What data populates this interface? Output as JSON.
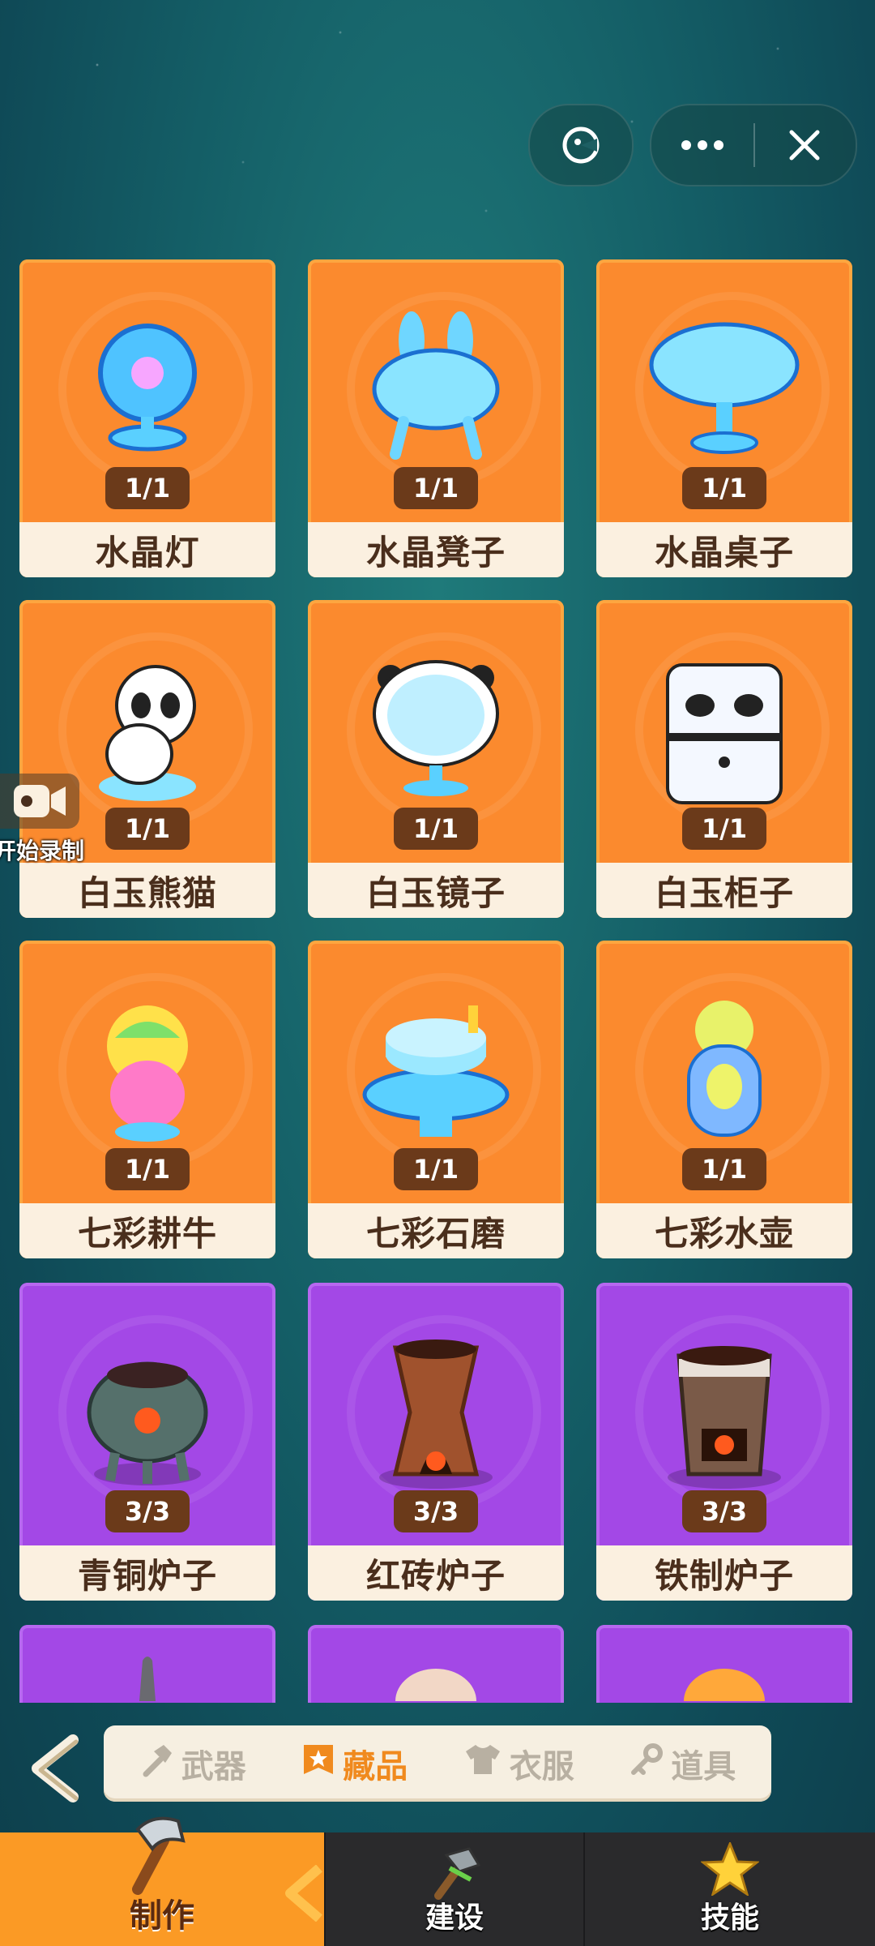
{
  "cards": [
    {
      "name": "水晶灯",
      "count": "1/1",
      "tier": "orange"
    },
    {
      "name": "水晶凳子",
      "count": "1/1",
      "tier": "orange"
    },
    {
      "name": "水晶桌子",
      "count": "1/1",
      "tier": "orange"
    },
    {
      "name": "白玉熊猫",
      "count": "1/1",
      "tier": "orange"
    },
    {
      "name": "白玉镜子",
      "count": "1/1",
      "tier": "orange"
    },
    {
      "name": "白玉柜子",
      "count": "1/1",
      "tier": "orange"
    },
    {
      "name": "七彩耕牛",
      "count": "1/1",
      "tier": "orange"
    },
    {
      "name": "七彩石磨",
      "count": "1/1",
      "tier": "orange"
    },
    {
      "name": "七彩水壶",
      "count": "1/1",
      "tier": "orange"
    },
    {
      "name": "青铜炉子",
      "count": "3/3",
      "tier": "purple"
    },
    {
      "name": "红砖炉子",
      "count": "3/3",
      "tier": "purple"
    },
    {
      "name": "铁制炉子",
      "count": "3/3",
      "tier": "purple"
    }
  ],
  "record": {
    "label": "开始录制"
  },
  "categories": [
    {
      "label": "武器",
      "icon": "hammer-icon",
      "active": false
    },
    {
      "label": "藏品",
      "icon": "star-badge-icon",
      "active": true
    },
    {
      "label": "衣服",
      "icon": "shirt-icon",
      "active": false
    },
    {
      "label": "道具",
      "icon": "key-icon",
      "active": false
    }
  ],
  "nav": {
    "make": "制作",
    "build": "建设",
    "skill": "技能"
  },
  "colors": {
    "orange_card": "#fb8a2e",
    "purple_card": "#a348e6",
    "accent": "#f08a1e"
  }
}
